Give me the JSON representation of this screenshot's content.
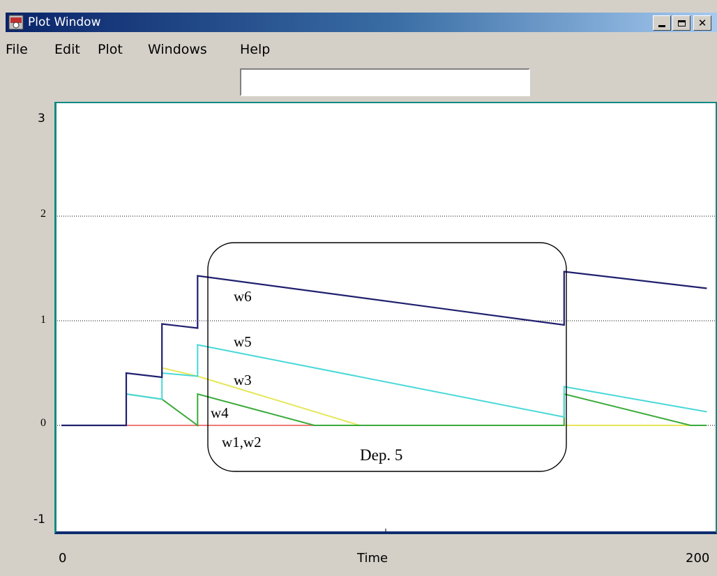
{
  "window": {
    "title": "Plot Window"
  },
  "menu": [
    "File",
    "Edit",
    "Plot",
    "Windows",
    "Help"
  ],
  "input": {
    "value": ""
  },
  "colors": {
    "w6": "#1f1f6e",
    "w5": "#48d8d8",
    "w3": "#e6e65a",
    "w4": "#3aaa3a",
    "w1w2": "#f07a7a",
    "grid": "#000000"
  },
  "chart_data": {
    "type": "line",
    "xlabel": "Time",
    "ylabel": "",
    "xlim": [
      0,
      200
    ],
    "ylim": [
      -1,
      3
    ],
    "x_tick_labels": [
      "0",
      "Time",
      "200"
    ],
    "y_ticks": [
      {
        "value": 3,
        "label": "3"
      },
      {
        "value": 2,
        "label": "2"
      },
      {
        "value": 1,
        "label": "1"
      },
      {
        "value": 0,
        "label": "0"
      },
      {
        "value": -1,
        "label": "-1"
      }
    ],
    "grid_y": [
      2,
      1,
      0
    ],
    "series": [
      {
        "name": "w6",
        "color": "#1f1f6e",
        "points": [
          [
            0,
            0
          ],
          [
            20,
            0
          ],
          [
            20,
            0.5
          ],
          [
            31,
            0.46
          ],
          [
            31,
            0.97
          ],
          [
            42,
            0.93
          ],
          [
            42,
            1.43
          ],
          [
            155,
            0.96
          ],
          [
            155,
            1.47
          ],
          [
            199,
            1.31
          ]
        ]
      },
      {
        "name": "w5",
        "color": "#48d8d8",
        "points": [
          [
            20,
            0
          ],
          [
            20,
            0.3
          ],
          [
            31,
            0.25
          ],
          [
            31,
            0.5
          ],
          [
            42,
            0.47
          ],
          [
            42,
            0.77
          ],
          [
            155,
            0.08
          ],
          [
            155,
            0.37
          ],
          [
            199,
            0.13
          ]
        ]
      },
      {
        "name": "w3",
        "color": "#e6e65a",
        "points": [
          [
            31,
            0.5
          ],
          [
            31,
            0.55
          ],
          [
            42,
            0.47
          ],
          [
            92,
            0
          ],
          [
            199,
            0
          ]
        ]
      },
      {
        "name": "w4",
        "color": "#3aaa3a",
        "points": [
          [
            20,
            0.3
          ],
          [
            31,
            0.25
          ],
          [
            42,
            0
          ],
          [
            42,
            0.3
          ],
          [
            78,
            0
          ],
          [
            155,
            0
          ],
          [
            155,
            0.3
          ],
          [
            194,
            0
          ],
          [
            199,
            0
          ]
        ]
      },
      {
        "name": "w1,w2",
        "color": "#f07a7a",
        "points": [
          [
            20,
            0
          ],
          [
            199,
            0
          ]
        ]
      }
    ],
    "annotations": [
      "w6",
      "w5",
      "w3",
      "w4",
      "w1,w2",
      "Dep. 5"
    ]
  }
}
